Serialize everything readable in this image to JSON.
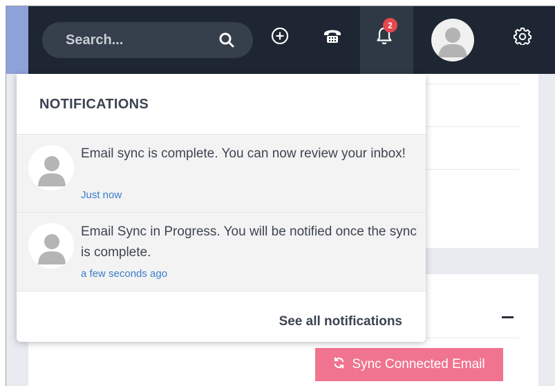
{
  "search": {
    "placeholder": "Search..."
  },
  "topbar": {
    "icons": [
      "search-icon",
      "plus-circle-icon",
      "phone-icon",
      "bell-icon",
      "avatar",
      "gear-icon"
    ],
    "notification_badge": "2"
  },
  "notifications": {
    "title": "NOTIFICATIONS",
    "items": [
      {
        "message": "Email sync is complete. You can now review your inbox!",
        "time": "Just now"
      },
      {
        "message": "Email Sync in Progress. You will be notified once the sync is complete.",
        "time": "a few seconds ago"
      }
    ],
    "see_all": "See all notifications"
  },
  "main": {
    "sync_button": "Sync Connected Email"
  },
  "colors": {
    "topbar": "#1d2632",
    "accent_pink": "#f0748f",
    "badge_red": "#e5484d",
    "link_blue": "#3a7cc7"
  }
}
